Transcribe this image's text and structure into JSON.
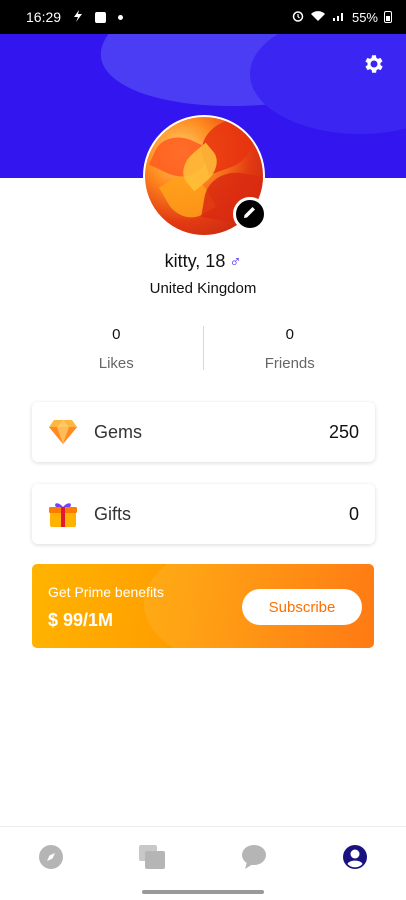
{
  "status_bar": {
    "time": "16:29",
    "battery": "55%"
  },
  "profile": {
    "name_age": "kitty, 18",
    "gender_symbol": "♂",
    "country": "United Kingdom"
  },
  "stats": [
    {
      "value": "0",
      "label": "Likes"
    },
    {
      "value": "0",
      "label": "Friends"
    }
  ],
  "cards": {
    "gems": {
      "label": "Gems",
      "value": "250",
      "icon": "diamond-icon"
    },
    "gifts": {
      "label": "Gifts",
      "value": "0",
      "icon": "gift-icon"
    }
  },
  "promo": {
    "title": "Get Prime benefits",
    "price": "$ 99/1M",
    "button": "Subscribe"
  },
  "colors": {
    "header": "#3315f0",
    "accent_orange": "#ff6f00",
    "gender": "#3315f0"
  },
  "nav": {
    "items": [
      "compass-icon",
      "cards-icon",
      "chat-icon",
      "profile-icon"
    ],
    "active": "profile-icon"
  }
}
